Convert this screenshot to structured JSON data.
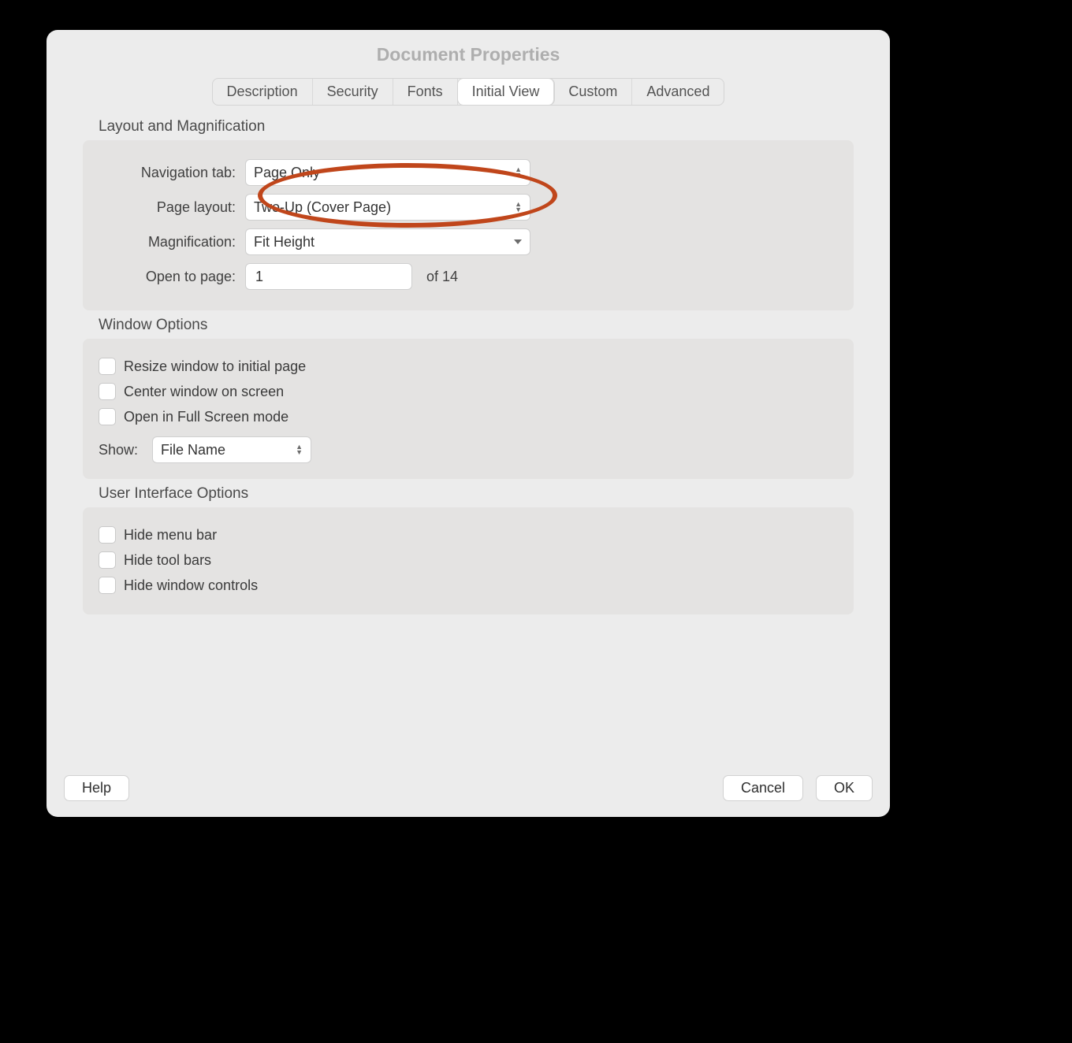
{
  "title": "Document Properties",
  "tabs": [
    "Description",
    "Security",
    "Fonts",
    "Initial View",
    "Custom",
    "Advanced"
  ],
  "activeTab": 3,
  "layout": {
    "heading": "Layout and Magnification",
    "navLabel": "Navigation tab:",
    "navValue": "Page Only",
    "pageLayoutLabel": "Page layout:",
    "pageLayoutValue": "Two-Up (Cover Page)",
    "magLabel": "Magnification:",
    "magValue": "Fit Height",
    "openLabel": "Open to page:",
    "openValue": "1",
    "ofText": "of 14"
  },
  "windowOpts": {
    "heading": "Window Options",
    "resize": "Resize window to initial page",
    "center": "Center window on screen",
    "fullscreen": "Open in Full Screen mode",
    "showLabel": "Show:",
    "showValue": "File Name"
  },
  "uiOpts": {
    "heading": "User Interface Options",
    "hideMenu": "Hide menu bar",
    "hideTool": "Hide tool bars",
    "hideWin": "Hide window controls"
  },
  "buttons": {
    "help": "Help",
    "cancel": "Cancel",
    "ok": "OK"
  }
}
